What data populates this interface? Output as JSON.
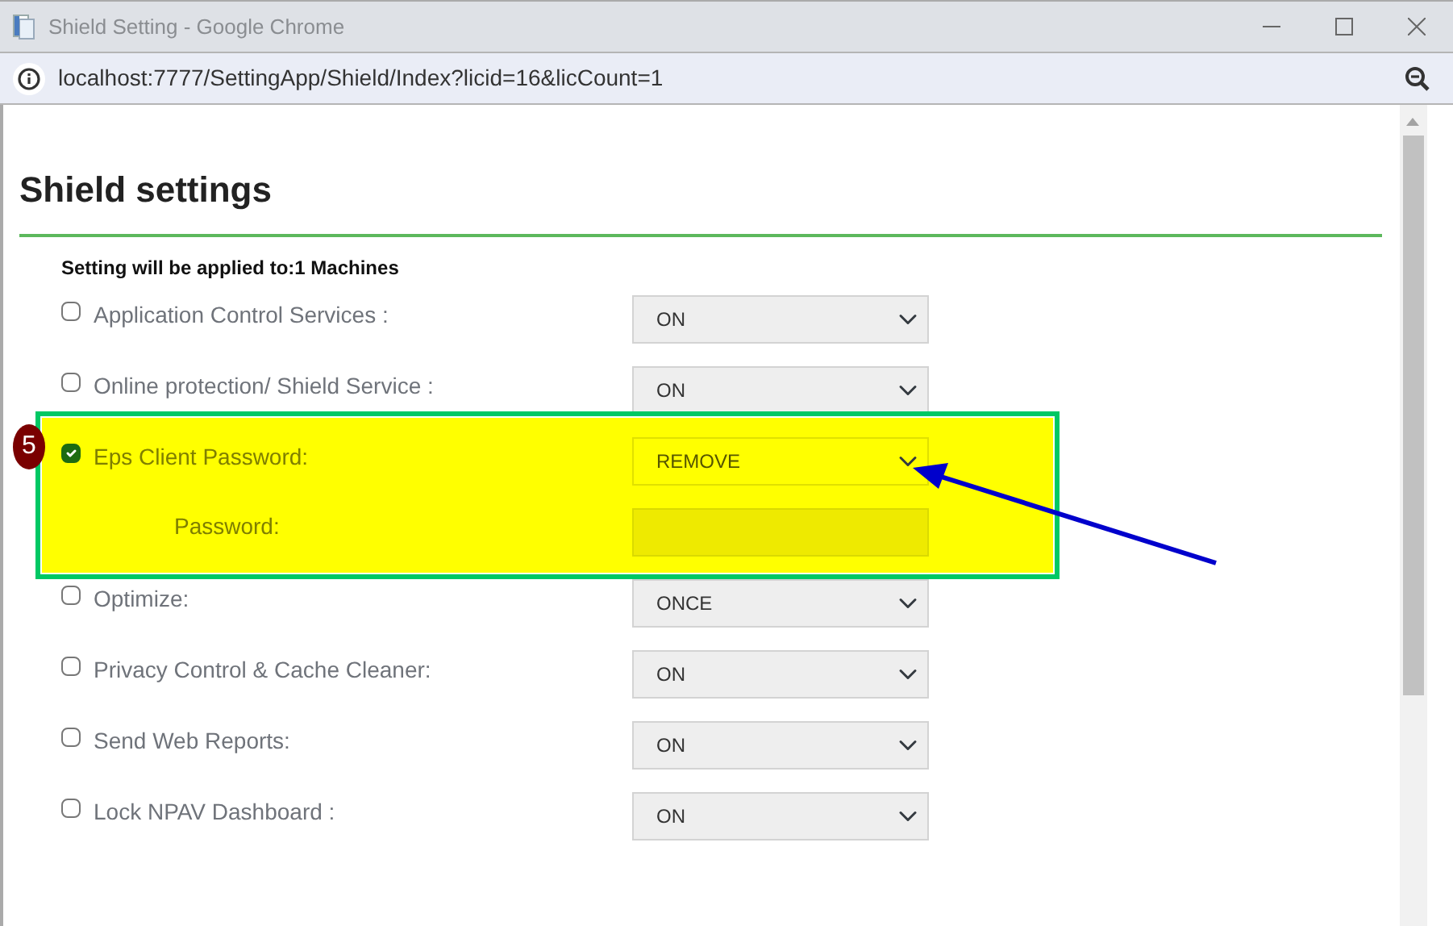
{
  "window": {
    "title": "Shield Setting - Google Chrome"
  },
  "address_bar": {
    "url": "localhost:7777/SettingApp/Shield/Index?licid=16&licCount=1"
  },
  "page": {
    "heading": "Shield settings",
    "applies_to": "Setting will be applied to:1 Machines",
    "settings": [
      {
        "label": "Application Control Services :",
        "checked": false,
        "value": "ON",
        "highlighted": false
      },
      {
        "label": "Online protection/ Shield Service :",
        "checked": false,
        "value": "ON",
        "highlighted": false
      },
      {
        "label": "Eps Client Password:",
        "checked": true,
        "value": "REMOVE",
        "highlighted": true,
        "step": "5",
        "sub_field": {
          "label": "Password:"
        }
      },
      {
        "label": "Optimize:",
        "checked": false,
        "value": "ONCE",
        "highlighted": false
      },
      {
        "label": "Privacy Control & Cache Cleaner:",
        "checked": false,
        "value": "ON",
        "highlighted": false
      },
      {
        "label": "Send Web Reports:",
        "checked": false,
        "value": "ON",
        "highlighted": false
      },
      {
        "label": "Lock NPAV Dashboard :",
        "checked": false,
        "value": "ON",
        "highlighted": false
      }
    ]
  }
}
